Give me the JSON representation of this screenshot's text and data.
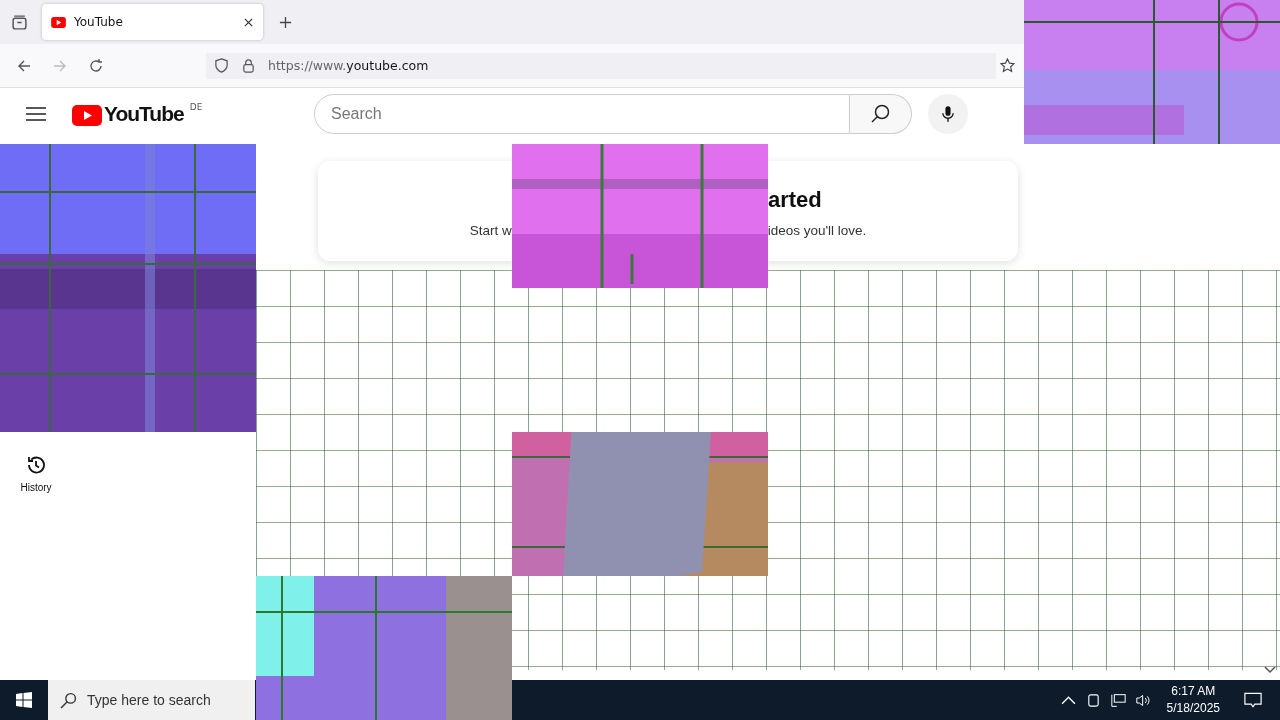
{
  "browser": {
    "tabs": [
      {
        "title": "YouTube",
        "selected": true
      }
    ],
    "url_prefix": "https://www.",
    "url_domain": "youtube.com"
  },
  "youtube": {
    "logo_text": "YouTube",
    "region": "DE",
    "search": {
      "placeholder": "Search"
    },
    "sidebar": [
      {
        "label": "History"
      }
    ],
    "card": {
      "title_fragment": "arted",
      "subtitle_fragments": [
        "Start w",
        "ideos you'll love."
      ]
    }
  },
  "taskbar": {
    "search_placeholder": "Type here to search",
    "time": "6:17 AM",
    "date": "5/18/2025"
  }
}
